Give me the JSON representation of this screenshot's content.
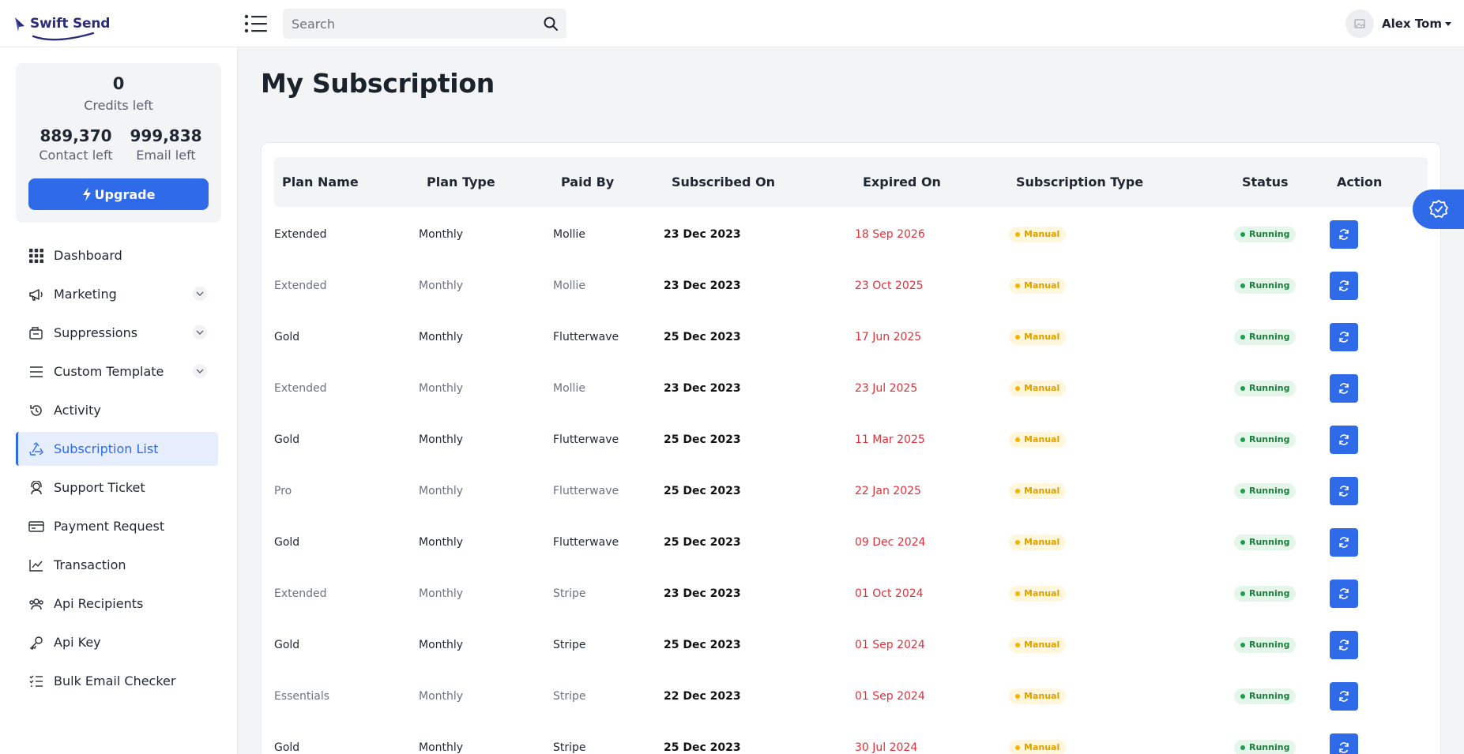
{
  "app": {
    "logo_text": "Swift Send",
    "colors": {
      "primary": "#2f6ae8",
      "brand": "#2b2d7a",
      "danger": "#e0313a",
      "warning": "#f5b400",
      "success": "#1e9e4a"
    }
  },
  "header": {
    "search_placeholder": "Search",
    "search_value": "",
    "user_name": "Alex Tom"
  },
  "credits": {
    "credits_value": "0",
    "credits_label": "Credits left",
    "contact_value": "889,370",
    "contact_label": "Contact left",
    "email_value": "999,838",
    "email_label": "Email left",
    "upgrade_label": "Upgrade"
  },
  "sidebar": {
    "items": [
      {
        "label": "Dashboard",
        "icon": "grid-icon"
      },
      {
        "label": "Marketing",
        "icon": "megaphone-icon",
        "expandable": true
      },
      {
        "label": "Suppressions",
        "icon": "suppression-icon",
        "expandable": true
      },
      {
        "label": "Custom Template",
        "icon": "list-lines-icon",
        "expandable": true
      },
      {
        "label": "Activity",
        "icon": "history-icon"
      },
      {
        "label": "Subscription List",
        "icon": "recycle-icon",
        "active": true
      },
      {
        "label": "Support Ticket",
        "icon": "support-icon"
      },
      {
        "label": "Payment Request",
        "icon": "money-card-icon"
      },
      {
        "label": "Transaction",
        "icon": "chart-line-icon"
      },
      {
        "label": "Api Recipients",
        "icon": "users-icon"
      },
      {
        "label": "Api Key",
        "icon": "key-icon"
      },
      {
        "label": "Bulk Email Checker",
        "icon": "checklist-icon"
      }
    ]
  },
  "main": {
    "title": "My Subscription",
    "table": {
      "columns": [
        "Plan Name",
        "Plan Type",
        "Paid By",
        "Subscribed On",
        "Expired On",
        "Subscription Type",
        "Status",
        "Action"
      ],
      "rows": [
        {
          "plan": "Extended",
          "type": "Monthly",
          "paid_by": "Mollie",
          "subscribed": "23 Dec 2023",
          "expired": "18 Sep 2026",
          "sub_type": "Manual",
          "status": "Running",
          "muted": false
        },
        {
          "plan": "Extended",
          "type": "Monthly",
          "paid_by": "Mollie",
          "subscribed": "23 Dec 2023",
          "expired": "23 Oct 2025",
          "sub_type": "Manual",
          "status": "Running",
          "muted": true
        },
        {
          "plan": "Gold",
          "type": "Monthly",
          "paid_by": "Flutterwave",
          "subscribed": "25 Dec 2023",
          "expired": "17 Jun 2025",
          "sub_type": "Manual",
          "status": "Running",
          "muted": false
        },
        {
          "plan": "Extended",
          "type": "Monthly",
          "paid_by": "Mollie",
          "subscribed": "23 Dec 2023",
          "expired": "23 Jul 2025",
          "sub_type": "Manual",
          "status": "Running",
          "muted": true
        },
        {
          "plan": "Gold",
          "type": "Monthly",
          "paid_by": "Flutterwave",
          "subscribed": "25 Dec 2023",
          "expired": "11 Mar 2025",
          "sub_type": "Manual",
          "status": "Running",
          "muted": false
        },
        {
          "plan": "Pro",
          "type": "Monthly",
          "paid_by": "Flutterwave",
          "subscribed": "25 Dec 2023",
          "expired": "22 Jan 2025",
          "sub_type": "Manual",
          "status": "Running",
          "muted": true
        },
        {
          "plan": "Gold",
          "type": "Monthly",
          "paid_by": "Flutterwave",
          "subscribed": "25 Dec 2023",
          "expired": "09 Dec 2024",
          "sub_type": "Manual",
          "status": "Running",
          "muted": false
        },
        {
          "plan": "Extended",
          "type": "Monthly",
          "paid_by": "Stripe",
          "subscribed": "23 Dec 2023",
          "expired": "01 Oct 2024",
          "sub_type": "Manual",
          "status": "Running",
          "muted": true
        },
        {
          "plan": "Gold",
          "type": "Monthly",
          "paid_by": "Stripe",
          "subscribed": "25 Dec 2023",
          "expired": "01 Sep 2024",
          "sub_type": "Manual",
          "status": "Running",
          "muted": false
        },
        {
          "plan": "Essentials",
          "type": "Monthly",
          "paid_by": "Stripe",
          "subscribed": "22 Dec 2023",
          "expired": "01 Sep 2024",
          "sub_type": "Manual",
          "status": "Running",
          "muted": true
        },
        {
          "plan": "Gold",
          "type": "Monthly",
          "paid_by": "Stripe",
          "subscribed": "25 Dec 2023",
          "expired": "30 Jul 2024",
          "sub_type": "Manual",
          "status": "Running",
          "muted": false
        }
      ]
    }
  }
}
